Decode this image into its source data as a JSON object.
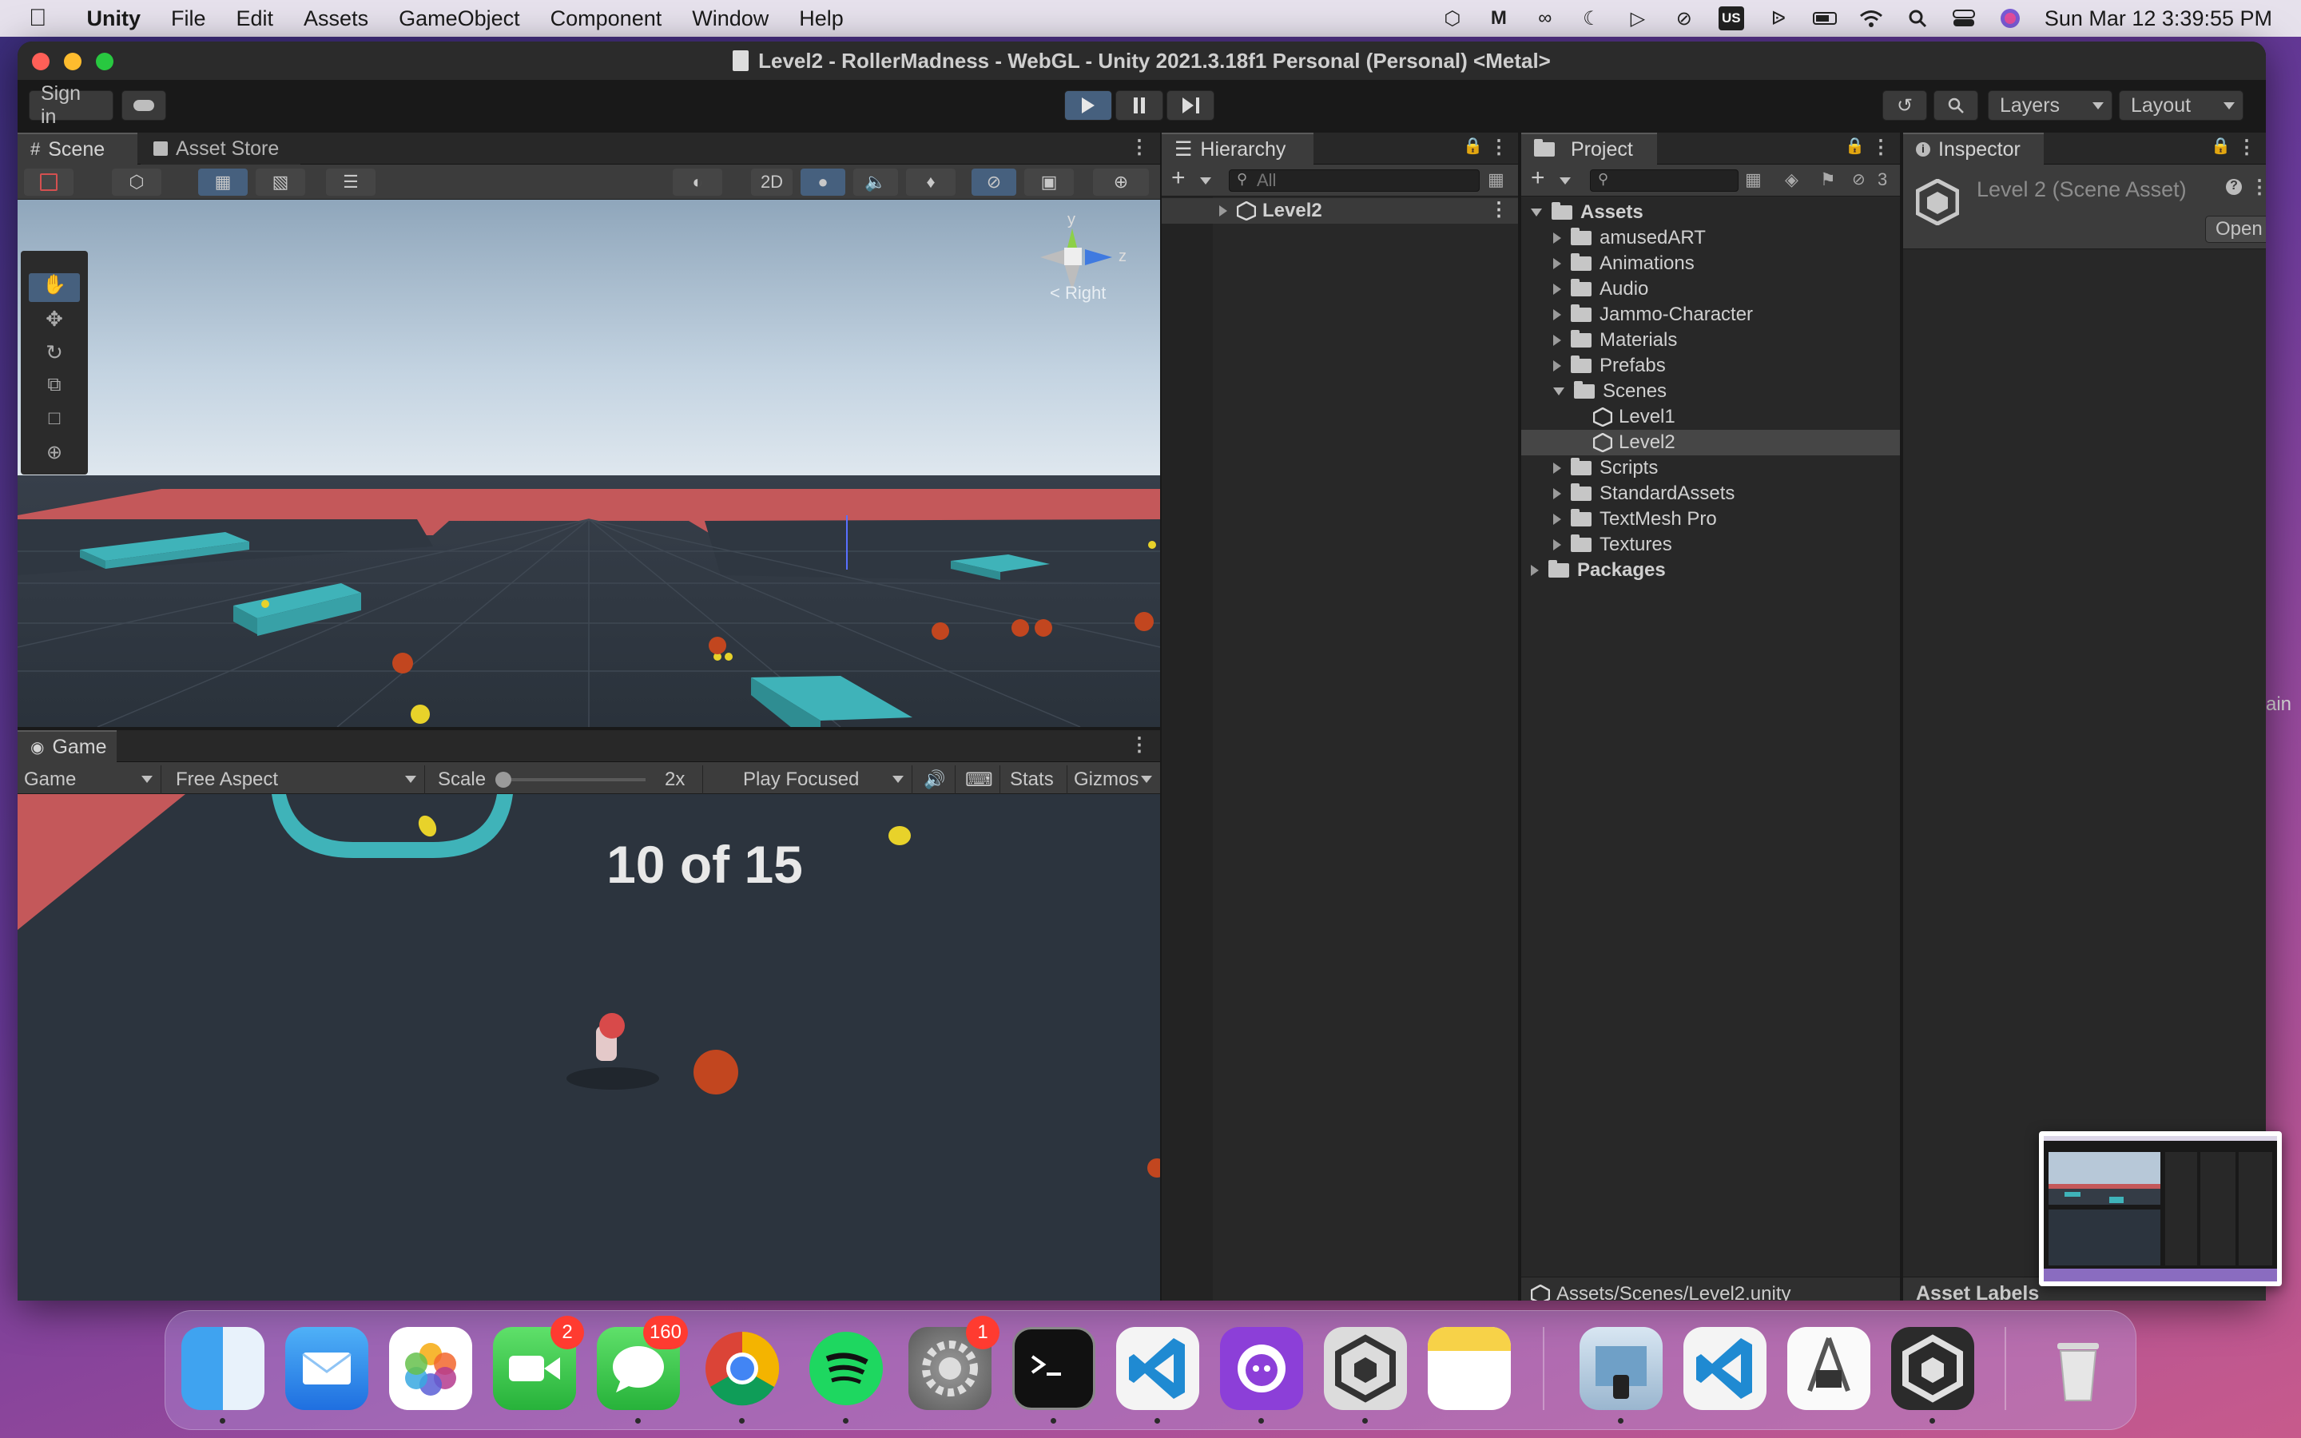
{
  "menubar": {
    "app": "Unity",
    "items": [
      "File",
      "Edit",
      "Assets",
      "GameObject",
      "Component",
      "Window",
      "Help"
    ],
    "clock": "Sun Mar 12  3:39:55 PM",
    "keyboard": "US"
  },
  "window": {
    "title": "Level2 - RollerMadness - WebGL - Unity 2021.3.18f1 Personal (Personal) <Metal>"
  },
  "toolbar": {
    "sign_in": "Sign in",
    "layers": "Layers",
    "layout": "Layout"
  },
  "scene": {
    "tabs": [
      "Scene",
      "Asset Store"
    ],
    "btn_2d": "2D",
    "gizmo_y": "y",
    "gizmo_z": "z",
    "gizmo_view": "< Right"
  },
  "hierarchy": {
    "tab": "Hierarchy",
    "search_placeholder": "All",
    "root": "Level2"
  },
  "project": {
    "tab": "Project",
    "hidden_count": "3",
    "assets_label": "Assets",
    "folders": [
      "amusedART",
      "Animations",
      "Audio",
      "Jammo-Character",
      "Materials",
      "Prefabs"
    ],
    "scenes_label": "Scenes",
    "scenes": [
      "Level1",
      "Level2"
    ],
    "folders_after": [
      "Scripts",
      "StandardAssets",
      "TextMesh Pro",
      "Textures"
    ],
    "packages_label": "Packages",
    "footer_path": "Assets/Scenes/Level2.unity"
  },
  "inspector": {
    "tab": "Inspector",
    "title": "Level 2 (Scene Asset)",
    "open_button": "Open",
    "asset_labels": "Asset Labels"
  },
  "game": {
    "tab": "Game",
    "display": "Game",
    "aspect": "Free Aspect",
    "scale_label": "Scale",
    "scale_value": "2x",
    "play_mode": "Play Focused",
    "stats": "Stats",
    "gizmos": "Gizmos",
    "hud_text": "10 of 15"
  },
  "desktop": {
    "edge_text": "ain"
  },
  "dock": {
    "apps": [
      "Finder",
      "Mail",
      "Photos",
      "FaceTime",
      "Messages",
      "Chrome",
      "Spotify",
      "System Preferences",
      "Terminal",
      "VS Code",
      "GitHub Desktop",
      "Unity Hub",
      "Notes",
      "Preview",
      "VS Code",
      "Instruments",
      "Unity",
      "Trash"
    ],
    "badges": {
      "facetime": "2",
      "messages": "160",
      "settings": "1"
    }
  },
  "colors": {
    "unity_dark": "#191919",
    "panel": "#282828",
    "accent_blue": "#46607e",
    "platform_cyan": "#3fb3b9",
    "floor_red": "#c4585a"
  }
}
